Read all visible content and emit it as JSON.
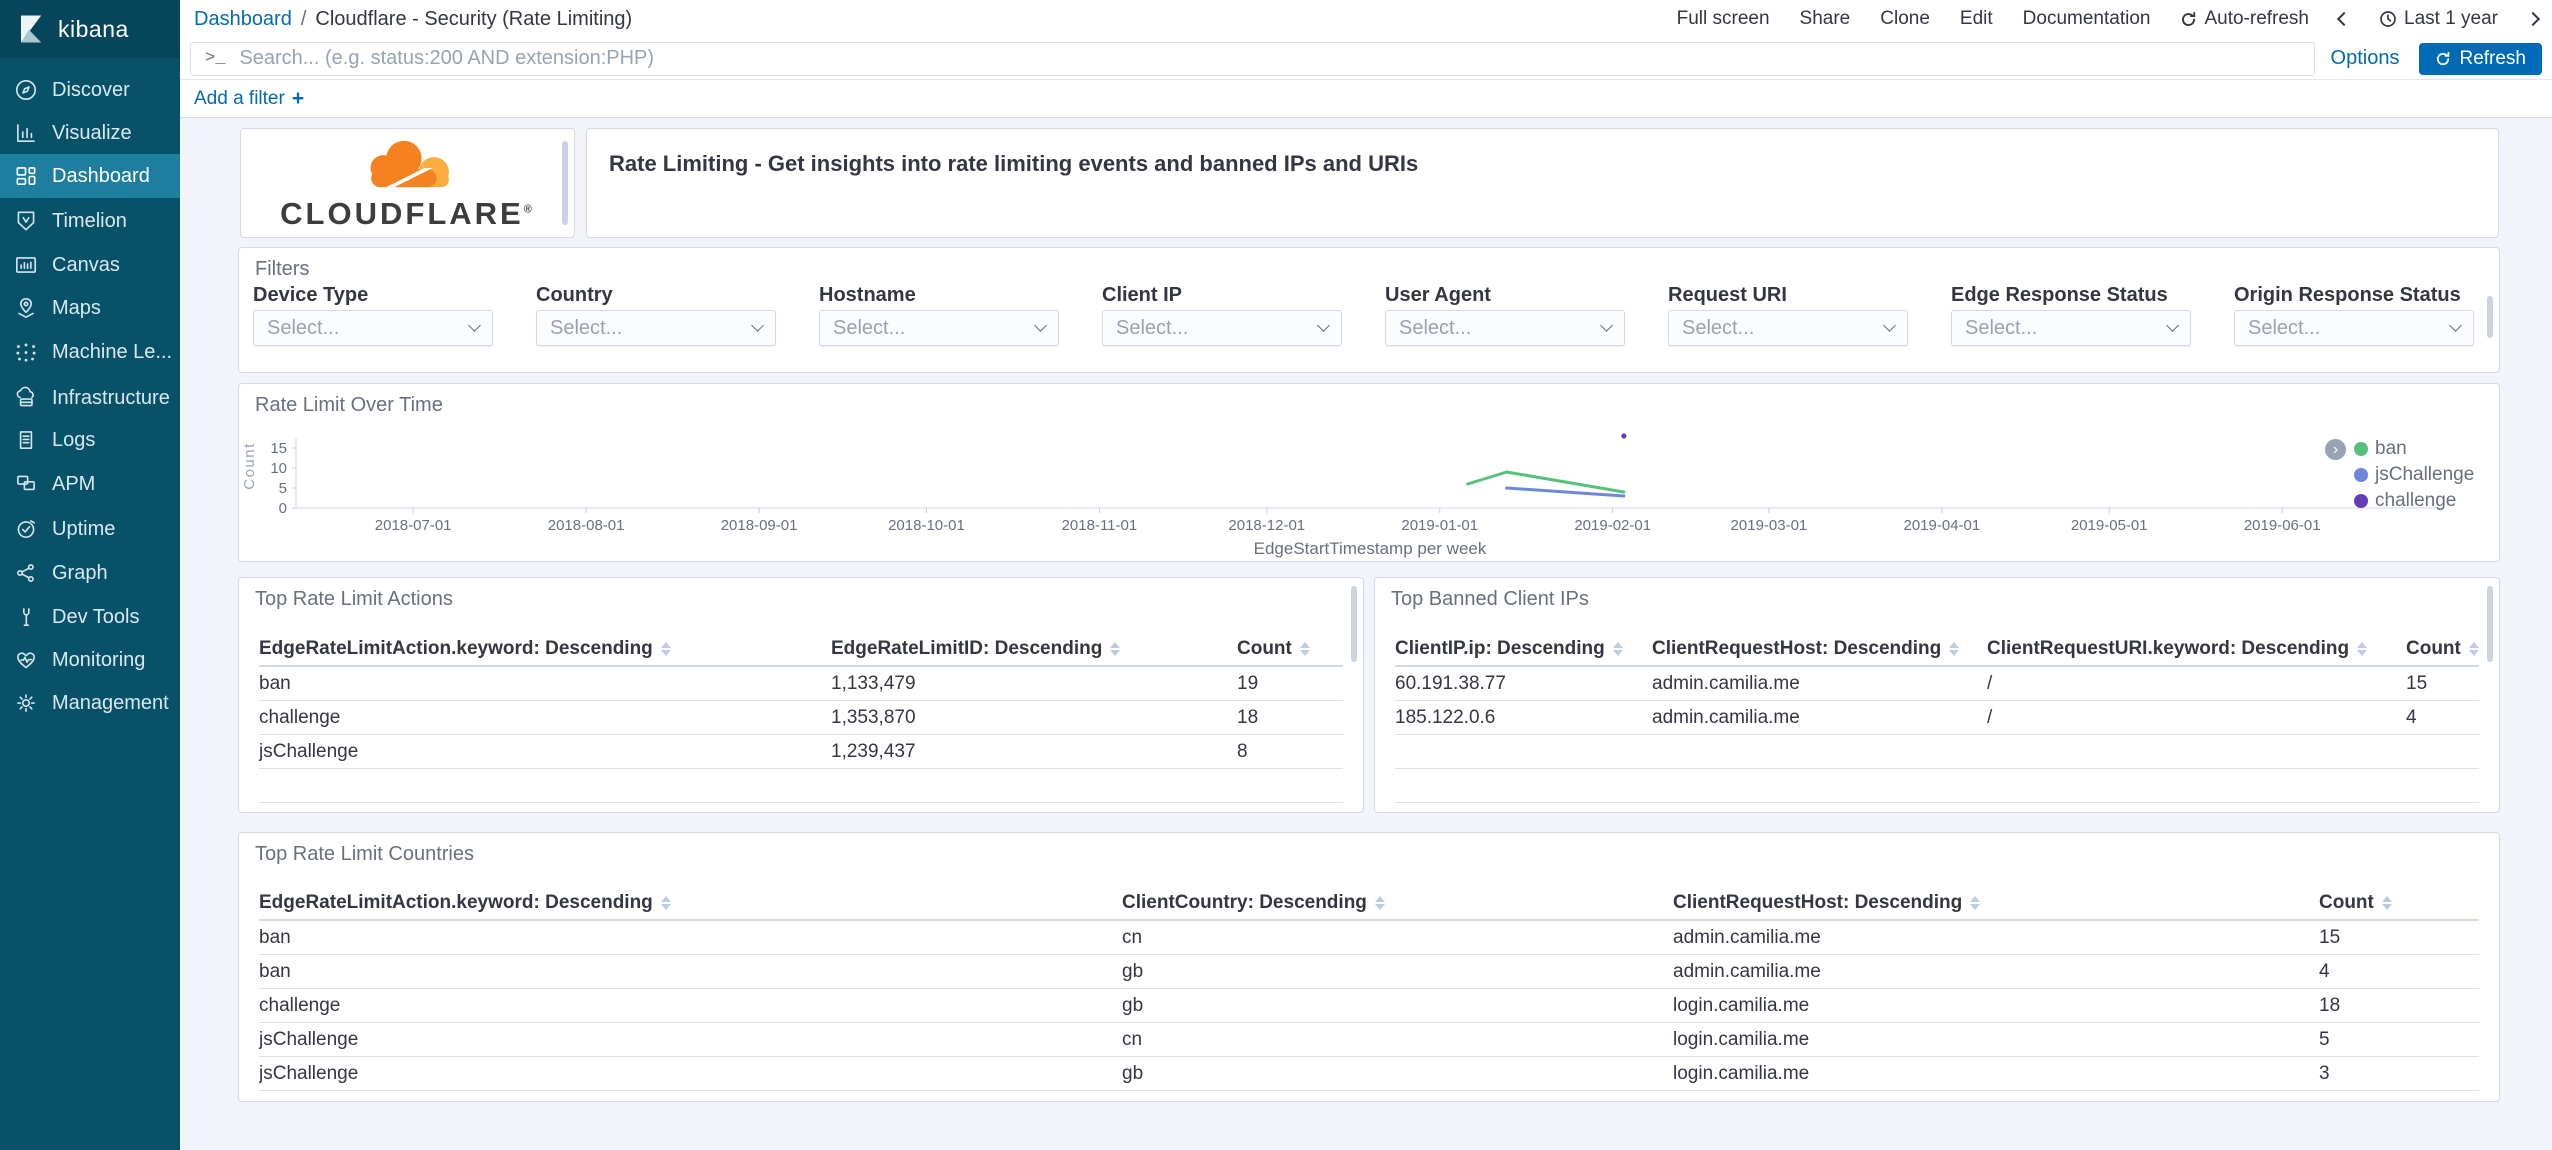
{
  "sidebar": {
    "logo_text": "kibana",
    "items": [
      {
        "label": "Discover"
      },
      {
        "label": "Visualize"
      },
      {
        "label": "Dashboard",
        "active": true
      },
      {
        "label": "Timelion"
      },
      {
        "label": "Canvas"
      },
      {
        "label": "Maps"
      },
      {
        "label": "Machine Le..."
      },
      {
        "label": "Infrastructure"
      },
      {
        "label": "Logs"
      },
      {
        "label": "APM"
      },
      {
        "label": "Uptime"
      },
      {
        "label": "Graph"
      },
      {
        "label": "Dev Tools"
      },
      {
        "label": "Monitoring"
      },
      {
        "label": "Management"
      }
    ]
  },
  "topbar": {
    "breadcrumb": {
      "link": "Dashboard",
      "separator": "/",
      "current": "Cloudflare - Security (Rate Limiting)"
    },
    "menu": [
      "Full screen",
      "Share",
      "Clone",
      "Edit",
      "Documentation"
    ],
    "auto_refresh_label": "Auto-refresh",
    "time_range_label": "Last 1 year",
    "search": {
      "prompt": ">_",
      "placeholder": "Search... (e.g. status:200 AND extension:PHP)"
    },
    "options_label": "Options",
    "refresh_label": "Refresh",
    "add_filter_label": "Add a filter",
    "add_filter_plus": "+"
  },
  "branding": {
    "wordmark": "CLOUDFLARE",
    "registered": "®",
    "banner_text": "Rate Limiting - Get insights into rate limiting events and banned IPs and URIs",
    "cloud_orange": "#F6821F",
    "cloud_light_orange": "#FBAD41"
  },
  "filters_panel": {
    "title": "Filters",
    "select_placeholder": "Select...",
    "fields": [
      "Device Type",
      "Country",
      "Hostname",
      "Client IP",
      "User Agent",
      "Request URI",
      "Edge Response Status",
      "Origin Response Status"
    ]
  },
  "icons": {
    "legend_toggle": "›"
  },
  "chart_data": {
    "type": "line",
    "title": "Rate Limit Over Time",
    "xlabel": "EdgeStartTimestamp per week",
    "ylabel": "Count",
    "x_domain": [
      "2018-06-10",
      "2019-06-30"
    ],
    "ylim": [
      0,
      21
    ],
    "yticks": [
      0,
      5,
      10,
      15
    ],
    "xticks": [
      "2018-07-01",
      "2018-08-01",
      "2018-09-01",
      "2018-10-01",
      "2018-11-01",
      "2018-12-01",
      "2019-01-01",
      "2019-02-01",
      "2019-03-01",
      "2019-04-01",
      "2019-05-01",
      "2019-06-01"
    ],
    "grid": false,
    "legend_position": "right",
    "series": [
      {
        "name": "ban",
        "color": "#57C17B",
        "points": [
          [
            "2019-01-06",
            6
          ],
          [
            "2019-01-13",
            9
          ],
          [
            "2019-02-03",
            4
          ]
        ]
      },
      {
        "name": "jsChallenge",
        "color": "#6F87D8",
        "points": [
          [
            "2019-01-13",
            5
          ],
          [
            "2019-02-03",
            3
          ]
        ]
      },
      {
        "name": "challenge",
        "color": "#663DB8",
        "points": [
          [
            "2019-02-03",
            18
          ]
        ]
      }
    ]
  },
  "tables": {
    "actions": {
      "title": "Top Rate Limit Actions",
      "columns": [
        "EdgeRateLimitAction.keyword: Descending",
        "EdgeRateLimitID: Descending",
        "Count"
      ],
      "rows": [
        [
          "ban",
          "1,133,479",
          "19"
        ],
        [
          "challenge",
          "1,353,870",
          "18"
        ],
        [
          "jsChallenge",
          "1,239,437",
          "8"
        ]
      ]
    },
    "banned": {
      "title": "Top Banned Client IPs",
      "columns": [
        "ClientIP.ip: Descending",
        "ClientRequestHost: Descending",
        "ClientRequestURI.keyword: Descending",
        "Count"
      ],
      "rows": [
        [
          "60.191.38.77",
          "admin.camilia.me",
          "/",
          "15"
        ],
        [
          "185.122.0.6",
          "admin.camilia.me",
          "/",
          "4"
        ]
      ]
    },
    "countries": {
      "title": "Top Rate Limit Countries",
      "columns": [
        "EdgeRateLimitAction.keyword: Descending",
        "ClientCountry: Descending",
        "ClientRequestHost: Descending",
        "Count"
      ],
      "rows": [
        [
          "ban",
          "cn",
          "admin.camilia.me",
          "15"
        ],
        [
          "ban",
          "gb",
          "admin.camilia.me",
          "4"
        ],
        [
          "challenge",
          "gb",
          "login.camilia.me",
          "18"
        ],
        [
          "jsChallenge",
          "cn",
          "login.camilia.me",
          "5"
        ],
        [
          "jsChallenge",
          "gb",
          "login.camilia.me",
          "3"
        ]
      ]
    }
  },
  "colors": {
    "link_blue": "#006BB4",
    "sidebar_bg": "#075169",
    "sidebar_active_bg": "#1D7EA0",
    "panel_border": "#D3DAE6",
    "content_bg": "#F2F4F9",
    "series_ban": "#57C17B",
    "series_jsChallenge": "#6F87D8",
    "series_challenge": "#663DB8"
  }
}
